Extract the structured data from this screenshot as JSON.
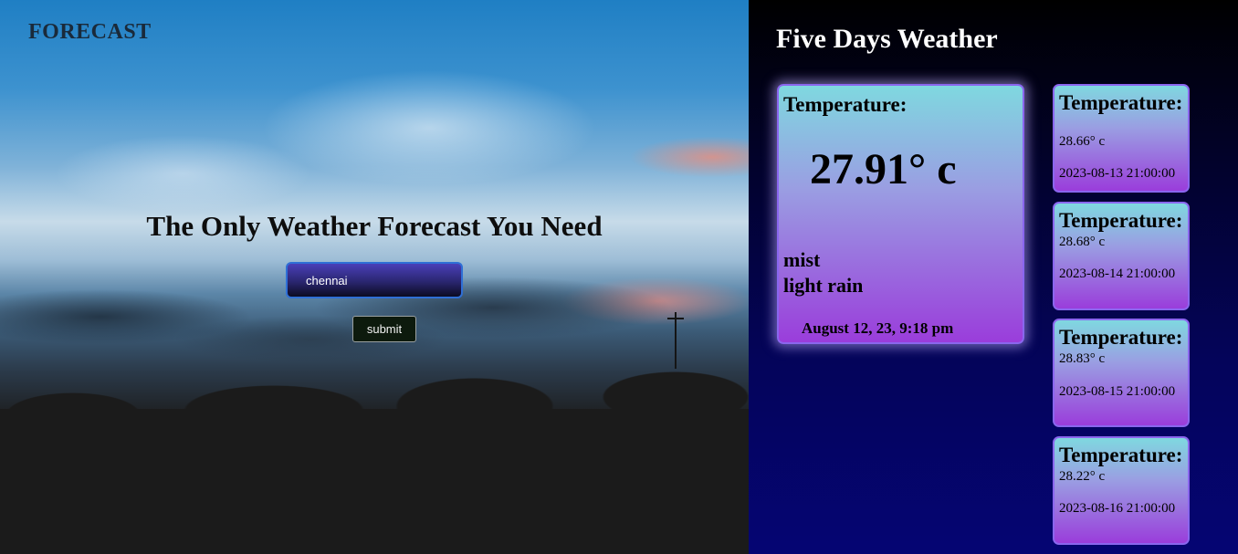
{
  "header": {
    "brand": "FORECAST"
  },
  "hero": {
    "headline": "The Only Weather Forecast You Need",
    "search": {
      "value": "chennai",
      "placeholder": ""
    },
    "submit_label": "submit"
  },
  "forecast": {
    "title": "Five Days Weather",
    "current": {
      "label": "Temperature:",
      "temperature": "27.91° c",
      "condition_main": "mist",
      "condition_desc": "light rain",
      "datetime": "August 12, 23, 9:18 pm"
    },
    "days": [
      {
        "label": "Temperature:",
        "temperature": "28.66° c",
        "datetime": "2023-08-13 21:00:00"
      },
      {
        "label": "Temperature:",
        "temperature": "28.68° c",
        "datetime": "2023-08-14 21:00:00"
      },
      {
        "label": "Temperature:",
        "temperature": "28.83° c",
        "datetime": "2023-08-15 21:00:00"
      },
      {
        "label": "Temperature:",
        "temperature": "28.22° c",
        "datetime": "2023-08-16 21:00:00"
      }
    ]
  },
  "colors": {
    "panel_bg_top": "#000000",
    "panel_bg_bottom": "#050573",
    "card_gradient_top": "#7fd8e0",
    "card_gradient_bottom": "#9a3ddb",
    "card_border": "#8a66ee",
    "input_border": "#2f6fd6"
  }
}
